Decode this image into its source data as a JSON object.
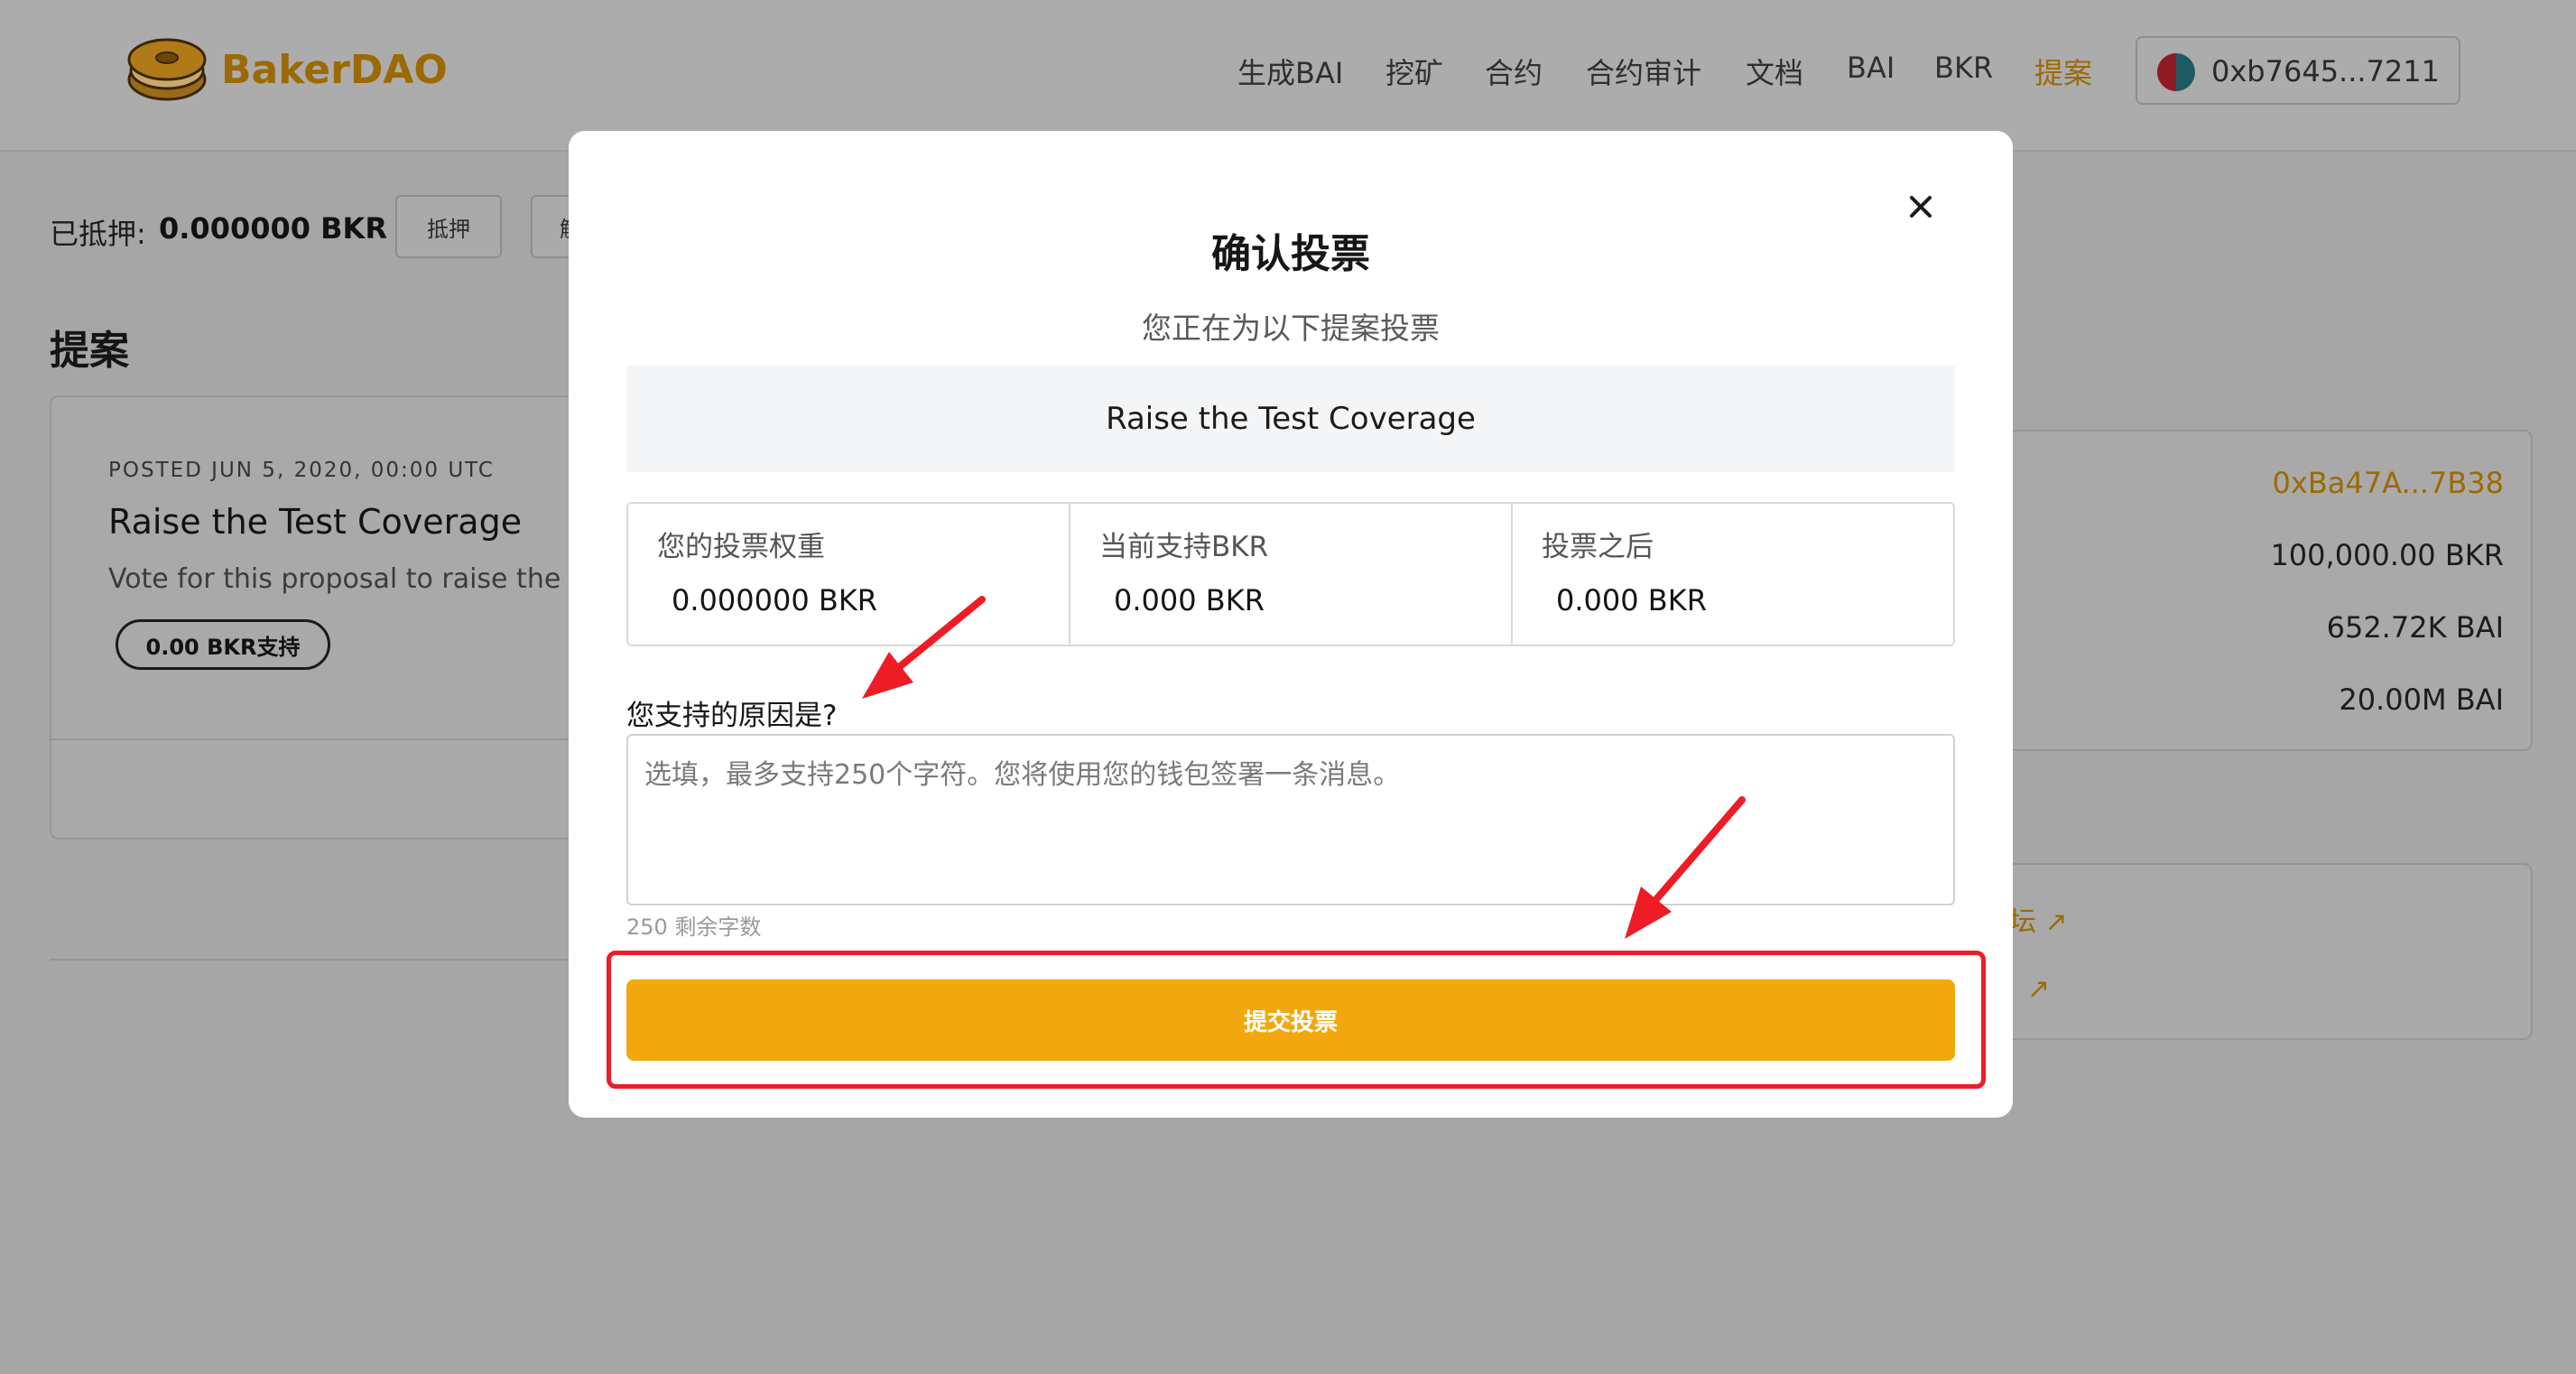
{
  "header": {
    "brand": "BakerDAO",
    "nav": [
      "生成BAI",
      "挖矿",
      "合约",
      "合约审计",
      "文档",
      "BAI",
      "BKR",
      "提案"
    ],
    "active_nav": "提案",
    "wallet_address": "0xb7645...7211"
  },
  "background": {
    "pledged_label": "已抵押:",
    "pledged_value": "0.000000 BKR",
    "pledge_button": "抵押",
    "unpledge_button": "解",
    "section_title": "提案",
    "proposal": {
      "posted": "POSTED JUN 5, 2020, 00:00 UTC",
      "title": "Raise the Test Coverage",
      "description": "Vote for this proposal to raise the Te",
      "support_pill": "0.00 BKR支持"
    },
    "right_card": {
      "address": "0xBa47A...7B38",
      "values": [
        "100,000.00 BKR",
        "652.72K BAI",
        "20.00M BAI"
      ]
    },
    "right_links": [
      "坛 ↗",
      "↗"
    ]
  },
  "modal": {
    "title": "确认投票",
    "subtitle": "您正在为以下提案投票",
    "proposal_title": "Raise the Test Coverage",
    "stats": [
      {
        "label": "您的投票权重",
        "value": "0.000000 BKR"
      },
      {
        "label": "当前支持BKR",
        "value": "0.000 BKR"
      },
      {
        "label": "投票之后",
        "value": "0.000 BKR"
      }
    ],
    "reason_label": "您支持的原因是?",
    "reason_placeholder": "选填，最多支持250个字符。您将使用您的钱包签署一条消息。",
    "remaining": "250 剩余字数",
    "submit_label": "提交投票"
  },
  "colors": {
    "accent": "#f2a80c",
    "brand": "#9c6a03",
    "annotation": "#ee1c25"
  }
}
